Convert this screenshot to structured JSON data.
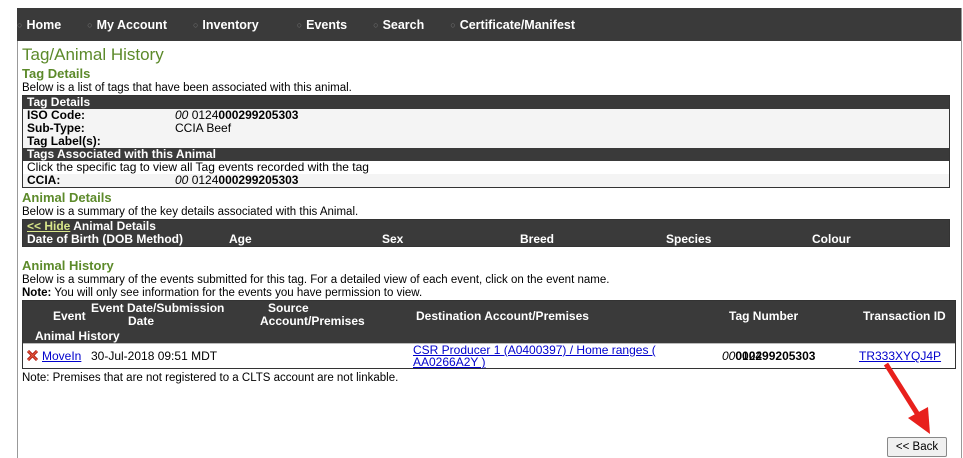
{
  "nav": {
    "items": [
      "Home",
      "My Account",
      "Inventory",
      "Events",
      "Search",
      "Certificate/Manifest"
    ]
  },
  "page_title": "Tag/Animal History",
  "tag_details": {
    "heading": "Tag Details",
    "description": "Below is a list of tags that have been associated with this animal.",
    "box_title": "Tag Details",
    "iso_label": "ISO Code:",
    "iso_prefix": "00",
    "iso_mid": " 0124",
    "iso_bold": "000299205303",
    "subtype_label": "Sub-Type:",
    "subtype_value": "CCIA Beef",
    "tag_label_label": "Tag Label(s):",
    "assoc_title": "Tags Associated with this Animal",
    "assoc_desc": "Click the specific tag to view all Tag events recorded with the tag",
    "ccia_label": "CCIA:"
  },
  "animal_details": {
    "heading": "Animal Details",
    "description": "Below is a summary of the key details associated with this Animal.",
    "hide_link": "<< Hide",
    "box_title": " Animal Details",
    "columns": [
      "Date of Birth (DOB Method)",
      "Age",
      "Sex",
      "Breed",
      "Species",
      "Colour"
    ]
  },
  "animal_history": {
    "heading": "Animal History",
    "description": "Below is a summary of the events submitted for this tag. For a detailed view of each event, click on the event name.",
    "note_label": "Note:",
    "note_text": " You will only see information for the events you have permission to view.",
    "col_event": "Event",
    "col_date_1": "Event Date/Submission",
    "col_date_2": "Date",
    "col_source_1": "Source",
    "col_source_2": "Account/Premises",
    "col_dest": "Destination Account/Premises",
    "col_tag": "Tag Number",
    "col_tx": "Transaction ID",
    "sub_header": "Animal History",
    "row": {
      "event": "MoveIn",
      "date": "30-Jul-2018 09:51 MDT",
      "dest_line1": "CSR Producer 1 (A0400397) / Home ranges (",
      "dest_line2": "AA0266A2Y )",
      "tag_prefix": "00",
      "tag_mid": " 0124",
      "tag_bold": "000299205303",
      "tx": "TR333XYQJ4P"
    }
  },
  "footer_note": "Note: Premises that are not registered to a CLTS account are not linkable.",
  "back_button": "<< Back",
  "colors": {
    "nav_bg": "#3a3a3a",
    "heading_green": "#5c8a2a",
    "arrow_red": "#e8201c"
  }
}
